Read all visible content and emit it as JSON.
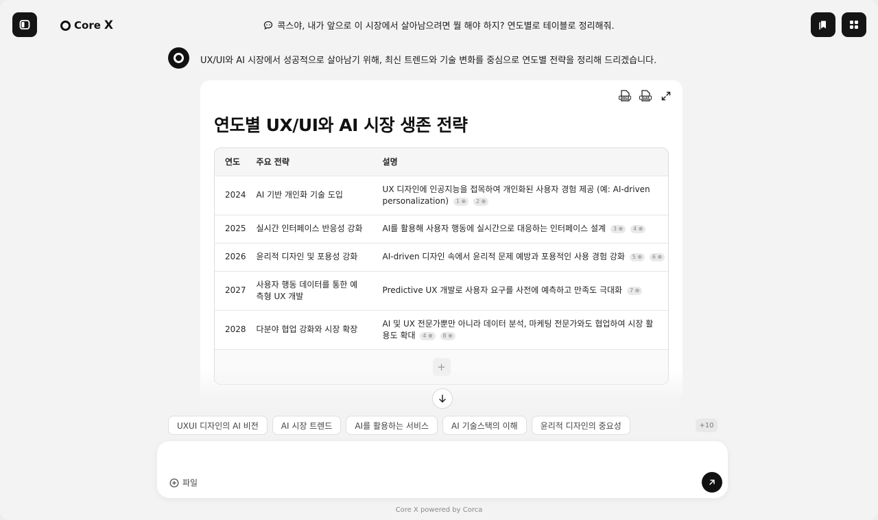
{
  "brand": {
    "name": "Core",
    "suffix": "X"
  },
  "user_message": "콕스야, 내가 앞으로 이 시장에서 살아남으려면 뭘 해야 하지? 연도별로 테이블로 정리해줘.",
  "assistant_message": "UX/UI와 AI 시장에서 성공적으로 살아남기 위해, 최신 트렌드와 기술 변화를 중심으로 연도별 전략을 정리해 드리겠습니다.",
  "card": {
    "title": "연도별 UX/UI와 AI 시장 생존 전략",
    "tools": [
      "docx-icon",
      "xlsx-icon",
      "expand-icon"
    ],
    "table": {
      "headers": [
        "연도",
        "주요 전략",
        "설명"
      ],
      "rows": [
        {
          "year": "2024",
          "strategy": "AI 기반 개인화 기술 도입",
          "desc": "UX 디자인에 인공지능을 접목하여 개인화된 사용자 경험 제공 (예: AI-driven personalization)",
          "cites": [
            "1",
            "2"
          ]
        },
        {
          "year": "2025",
          "strategy": "실시간 인터페이스 반응성 강화",
          "desc": "AI를 활용해 사용자 행동에 실시간으로 대응하는 인터페이스 설계",
          "cites": [
            "3",
            "4"
          ]
        },
        {
          "year": "2026",
          "strategy": "윤리적 디자인 및 포용성 강화",
          "desc": "AI-driven 디자인 속에서 윤리적 문제 예방과 포용적인 사용 경험 강화",
          "cites": [
            "5",
            "6"
          ]
        },
        {
          "year": "2027",
          "strategy": "사용자 행동 데이터를 통한 예측형 UX 개발",
          "desc": "Predictive UX 개발로 사용자 요구를 사전에 예측하고 만족도 극대화",
          "cites": [
            "7"
          ]
        },
        {
          "year": "2028",
          "strategy": "다분야 협업 강화와 시장 확장",
          "desc": "AI 및 UX 전문가뿐만 아니라 데이터 분석, 마케팅 전문가와도 협업하여 시장 활용도 확대",
          "cites": [
            "4",
            "8"
          ]
        }
      ],
      "add_label": "+"
    }
  },
  "suggestions": [
    "UXUI 디자인의 AI 비전",
    "AI 시장 트렌드",
    "AI를 활용하는 서비스",
    "AI 기술스택의 이해",
    "윤리적 디자인의 중요성"
  ],
  "more_suggestions": "+10",
  "composer": {
    "placeholder": "",
    "file_label": "파일"
  },
  "footer": "Core X powered by Corca"
}
